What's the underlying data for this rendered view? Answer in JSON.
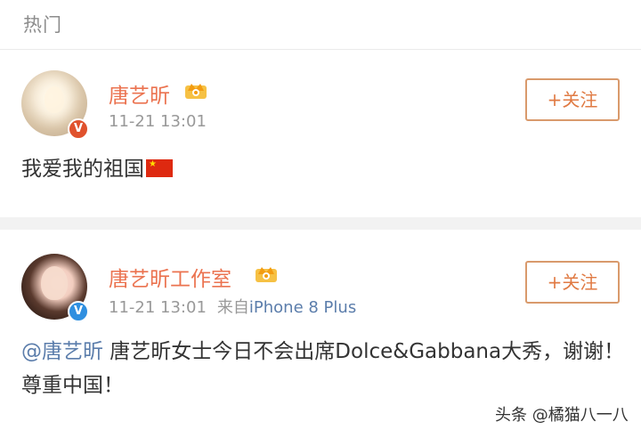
{
  "section": {
    "title": "热门"
  },
  "posts": [
    {
      "username": "唐艺昕",
      "timestamp": "11-21 13:01",
      "source_label": "",
      "source_device": "",
      "follow_label": "+关注",
      "text": "我爱我的祖国",
      "badge": "V",
      "badge_color": "#e0522d"
    },
    {
      "username": "唐艺昕工作室",
      "timestamp": "11-21 13:01",
      "source_label": "来自",
      "source_device": "iPhone 8 Plus",
      "follow_label": "+关注",
      "mention": "@唐艺昕",
      "text": " 唐艺昕女士今日不会出席Dolce&Gabbana大秀，谢谢！尊重中国！",
      "badge": "V",
      "badge_color": "#2f8fe0"
    }
  ],
  "watermark": "头条 @橘猫八一八",
  "colors": {
    "username": "#eb7350",
    "link": "#5b7dab",
    "follow_border": "#d99a6c"
  }
}
